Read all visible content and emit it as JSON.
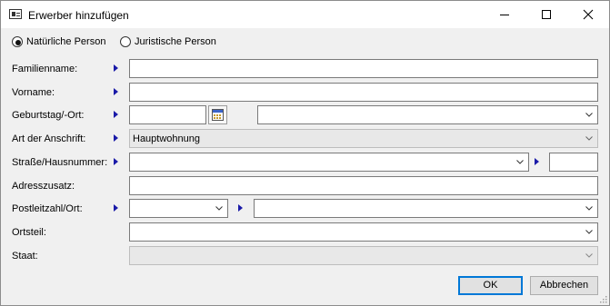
{
  "window": {
    "title": "Erwerber hinzufügen"
  },
  "person_type": {
    "options": [
      {
        "label": "Natürliche Person",
        "selected": true
      },
      {
        "label": "Juristische Person",
        "selected": false
      }
    ]
  },
  "form": {
    "familienname": {
      "label": "Familienname:",
      "value": ""
    },
    "vorname": {
      "label": "Vorname:",
      "value": ""
    },
    "geburtstag": {
      "label": "Geburtstag/-Ort:",
      "date_value": "",
      "place_value": ""
    },
    "anschrift": {
      "label": "Art der Anschrift:",
      "value": "Hauptwohnung"
    },
    "strasse": {
      "label": "Straße/Hausnummer:",
      "street_value": "",
      "number_value": ""
    },
    "adresszusatz": {
      "label": "Adresszusatz:",
      "value": ""
    },
    "postleitzahl": {
      "label": "Postleitzahl/Ort:",
      "plz_value": "",
      "ort_value": ""
    },
    "ortsteil": {
      "label": "Ortsteil:",
      "value": ""
    },
    "staat": {
      "label": "Staat:",
      "value": ""
    }
  },
  "buttons": {
    "ok": "OK",
    "cancel": "Abbrechen"
  },
  "colors": {
    "required_marker": "#1a1aa8",
    "default_button_border": "#0078d7"
  },
  "icons": [
    "window-icon",
    "minimize-icon",
    "maximize-icon",
    "close-icon",
    "required-arrow-icon",
    "calendar-icon",
    "chevron-down-icon",
    "resize-grip-icon"
  ]
}
